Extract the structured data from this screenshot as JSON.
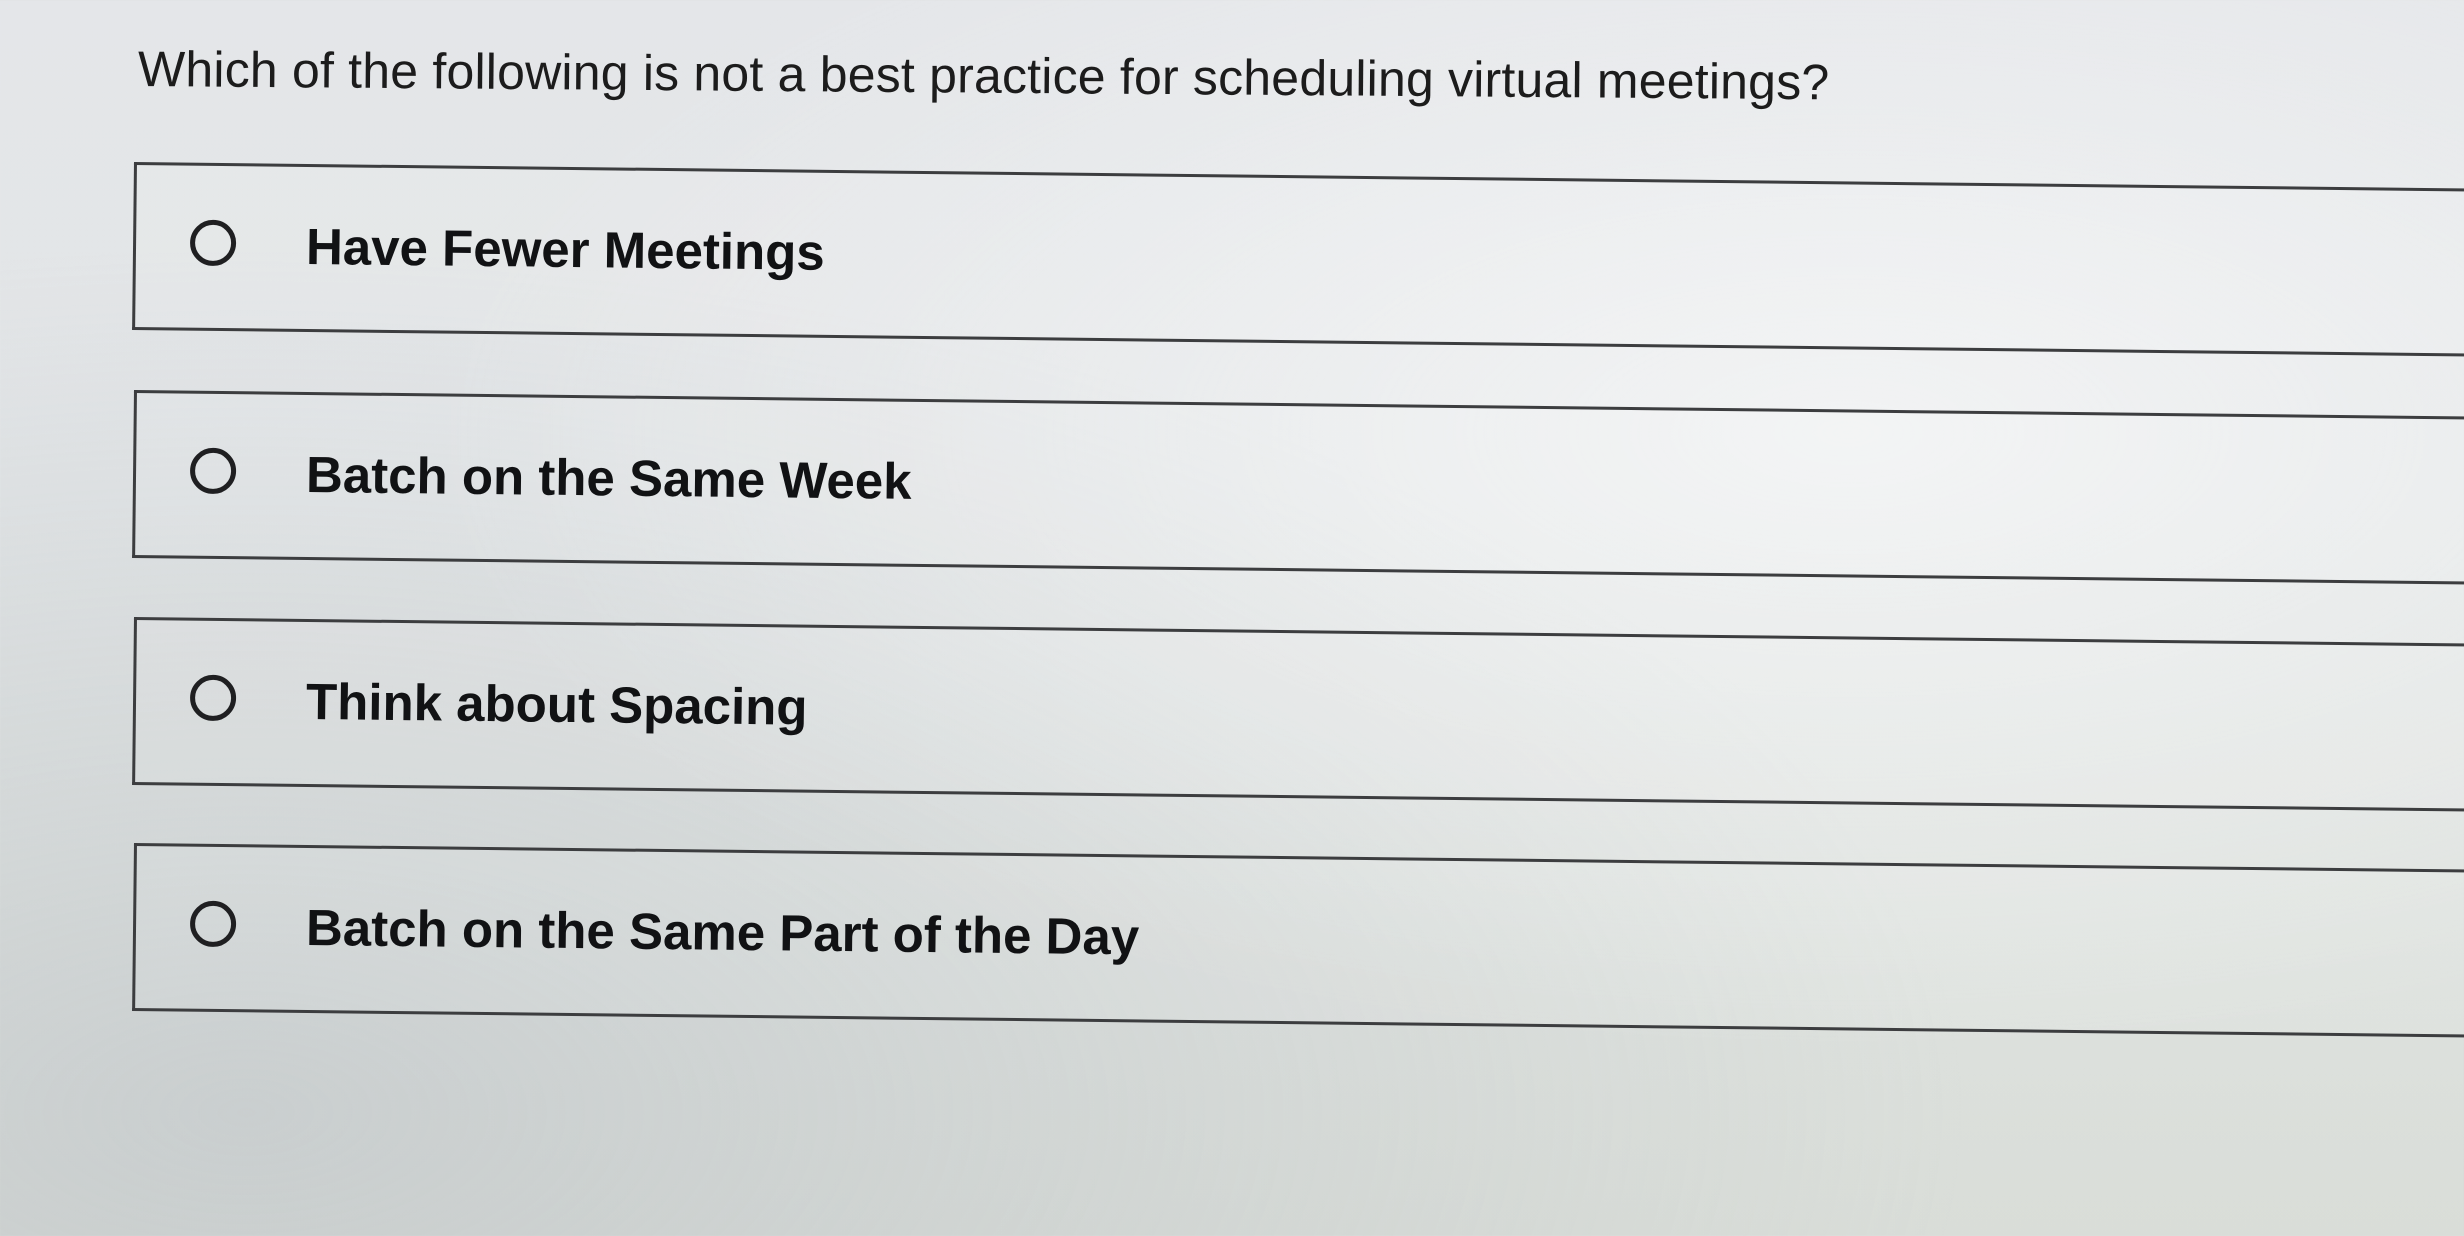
{
  "quiz": {
    "question": "Which of the following is not a best practice for scheduling virtual meetings?",
    "options": [
      {
        "label": "Have Fewer Meetings",
        "selected": false
      },
      {
        "label": "Batch on the Same Week",
        "selected": false
      },
      {
        "label": "Think about Spacing",
        "selected": false
      },
      {
        "label": "Batch on the Same Part of the Day",
        "selected": false
      }
    ]
  },
  "colors": {
    "text": "#1c1c1c",
    "border": "#3c3d3f",
    "radio": "#1f1f21"
  }
}
